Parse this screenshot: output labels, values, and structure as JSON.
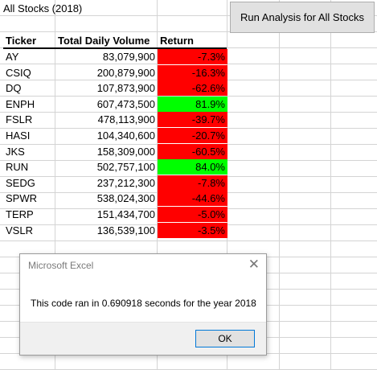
{
  "sheet": {
    "title_cell": "All Stocks (2018)",
    "headers": {
      "ticker": "Ticker",
      "volume": "Total Daily Volume",
      "return": "Return"
    },
    "rows": [
      {
        "ticker": "AY",
        "volume": "83,079,900",
        "return": "-7.3%",
        "status": "negative"
      },
      {
        "ticker": "CSIQ",
        "volume": "200,879,900",
        "return": "-16.3%",
        "status": "negative"
      },
      {
        "ticker": "DQ",
        "volume": "107,873,900",
        "return": "-62.6%",
        "status": "negative"
      },
      {
        "ticker": "ENPH",
        "volume": "607,473,500",
        "return": "81.9%",
        "status": "positive"
      },
      {
        "ticker": "FSLR",
        "volume": "478,113,900",
        "return": "-39.7%",
        "status": "negative"
      },
      {
        "ticker": "HASI",
        "volume": "104,340,600",
        "return": "-20.7%",
        "status": "negative"
      },
      {
        "ticker": "JKS",
        "volume": "158,309,000",
        "return": "-60.5%",
        "status": "negative"
      },
      {
        "ticker": "RUN",
        "volume": "502,757,100",
        "return": "84.0%",
        "status": "positive"
      },
      {
        "ticker": "SEDG",
        "volume": "237,212,300",
        "return": "-7.8%",
        "status": "negative"
      },
      {
        "ticker": "SPWR",
        "volume": "538,024,300",
        "return": "-44.6%",
        "status": "negative"
      },
      {
        "ticker": "TERP",
        "volume": "151,434,700",
        "return": "-5.0%",
        "status": "negative"
      },
      {
        "ticker": "VSLR",
        "volume": "136,539,100",
        "return": "-3.5%",
        "status": "negative"
      }
    ],
    "colors": {
      "negative": "#ff0000",
      "positive": "#00ff00"
    }
  },
  "toolbar": {
    "run_label": "Run Analysis for All Stocks"
  },
  "dialog": {
    "title": "Microsoft Excel",
    "close_glyph": "✕",
    "message": "This code ran in 0.690918 seconds for the year 2018",
    "ok_label": "OK"
  }
}
